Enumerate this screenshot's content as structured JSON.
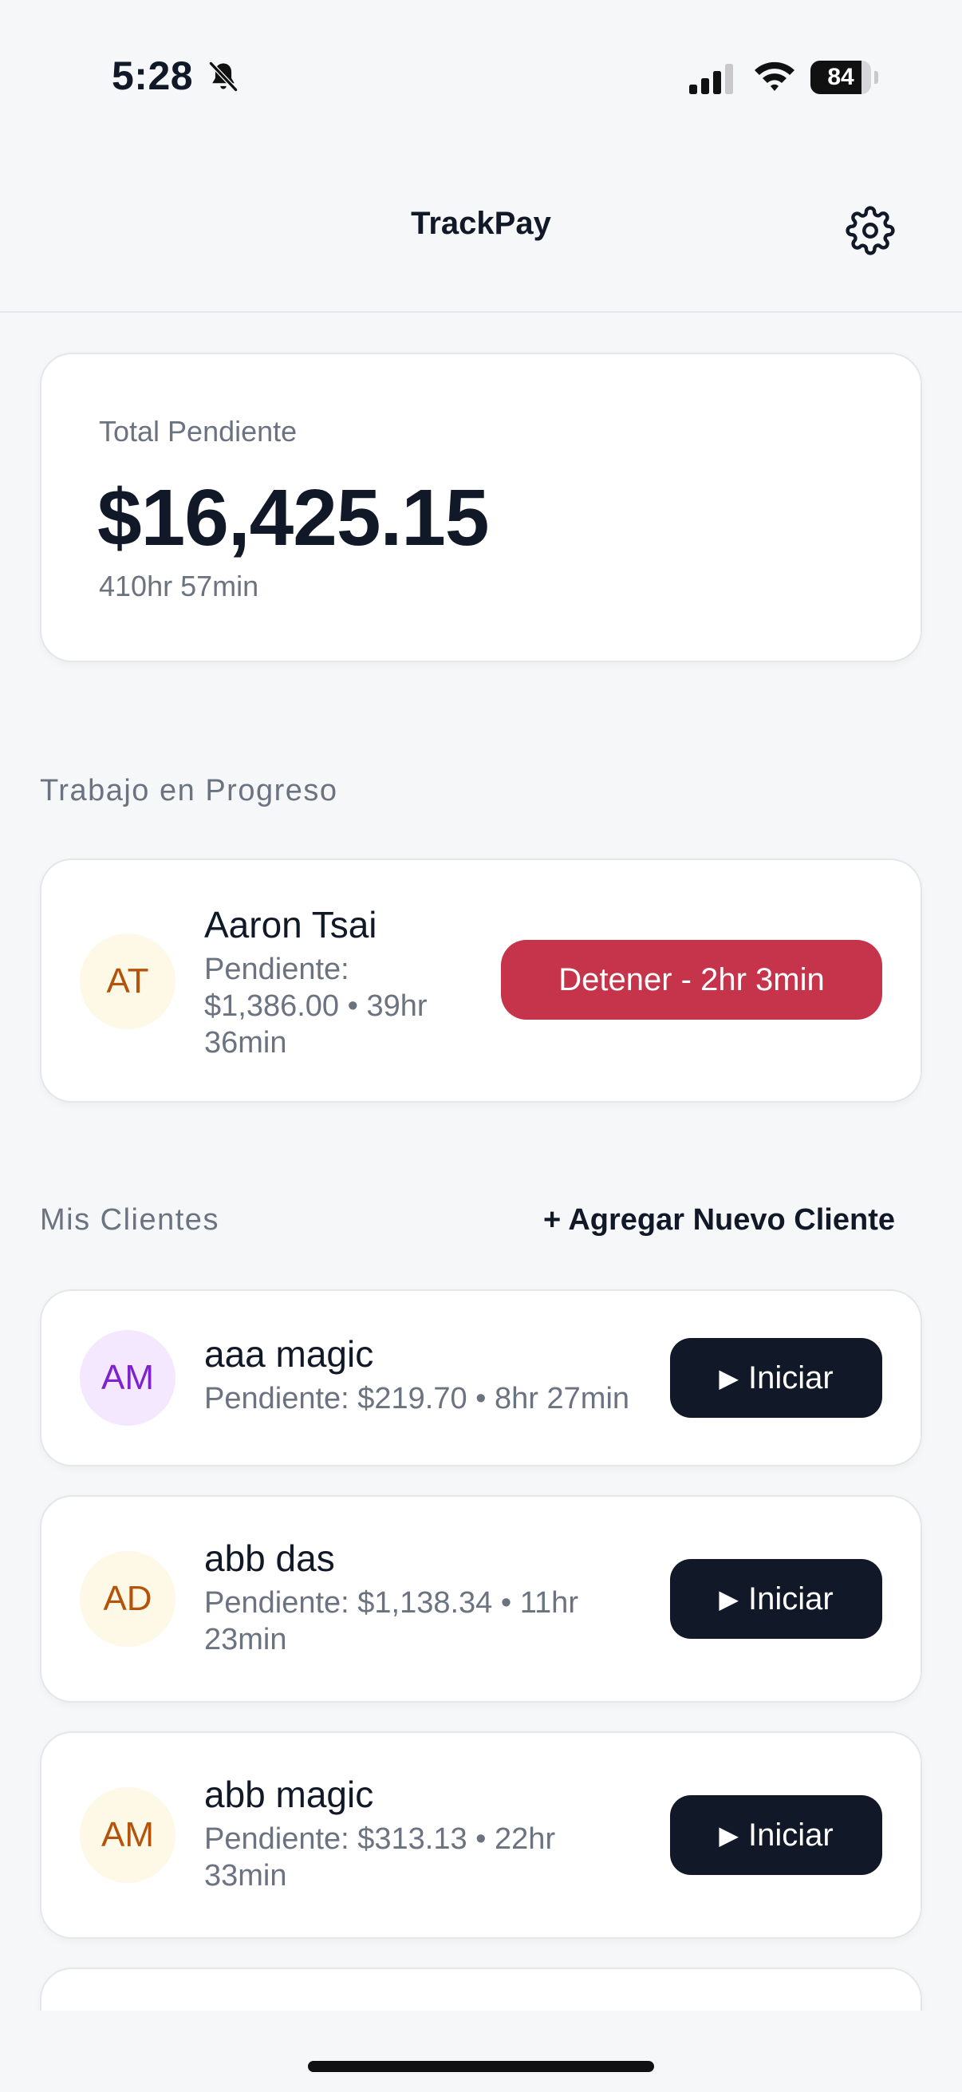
{
  "status_bar": {
    "time": "5:28",
    "battery_percent": 84,
    "battery_text": "84"
  },
  "nav": {
    "title": "TrackPay"
  },
  "summary": {
    "label": "Total Pendiente",
    "amount": "$16,425.15",
    "hours": "410hr 57min"
  },
  "in_progress": {
    "section_title": "Trabajo en Progreso",
    "client": {
      "initials": "AT",
      "name": "Aaron Tsai",
      "meta_line1": "Pendiente:",
      "meta_line2": "$1,386.00 • 39hr",
      "meta_line3": "36min",
      "stop_label": "Detener - 2hr 3min"
    }
  },
  "clients": {
    "section_title": "Mis Clientes",
    "add_label": "+ Agregar Nuevo Cliente",
    "start_label": "Iniciar",
    "items": [
      {
        "initials": "AM",
        "name": "aaa magic",
        "meta_line1": "Pendiente: $219.70 • 8hr 27min",
        "meta_line2": "",
        "avatar_color": "purple"
      },
      {
        "initials": "AD",
        "name": "abb das",
        "meta_line1": "Pendiente: $1,138.34 • 11hr",
        "meta_line2": "23min",
        "avatar_color": "yellow"
      },
      {
        "initials": "AM",
        "name": "abb magic",
        "meta_line1": "Pendiente: $313.13 • 22hr",
        "meta_line2": "33min",
        "avatar_color": "yellow"
      }
    ]
  },
  "colors": {
    "accent_dark": "#111827",
    "stop_red": "#c5344a",
    "muted_text": "#6b7280",
    "background": "#f6f7f9"
  }
}
